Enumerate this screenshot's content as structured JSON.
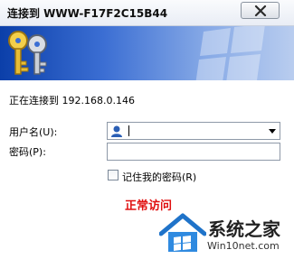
{
  "window": {
    "title": "连接到 WWW-F17F2C15B44"
  },
  "banner": {
    "icon": "keys-icon",
    "brand_color": "#0b3fa9"
  },
  "dialog": {
    "connecting_text": "正在连接到 192.168.0.146",
    "username_label": "用户名(U):",
    "username_value": "",
    "password_label": "密码(P):",
    "password_value": "",
    "remember_label": "记住我的密码(R)",
    "remember_checked": false
  },
  "annotation": {
    "text": "正常访问",
    "color": "#e01010"
  },
  "watermark": {
    "name": "系统之家",
    "url": "Win10net.com"
  }
}
